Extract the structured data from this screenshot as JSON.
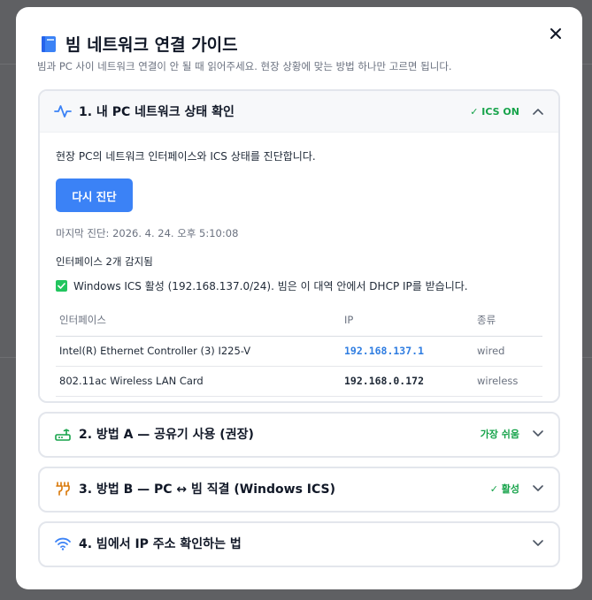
{
  "modal": {
    "title": "빔 네트워크 연결 가이드",
    "subtitle": "빔과 PC 사이 네트워크 연결이 안 될 때 읽어주세요. 현장 상황에 맞는 방법 하나만 고르면 됩니다."
  },
  "sections": [
    {
      "title": "1. 내 PC 네트워크 상태 확인",
      "badge": "✓ ICS ON",
      "icon": "activity-icon",
      "expanded": true,
      "description": "현장 PC의 네트워크 인터페이스와 ICS 상태를 진단합니다.",
      "button_label": "다시 진단",
      "last_diagnosis": "마지막 진단: 2026. 4. 24. 오후 5:10:08",
      "detected_text": "인터페이스 2개 감지됨",
      "ics_status": "Windows ICS 활성 (192.168.137.0/24). 빔은 이 대역 안에서 DHCP IP를 받습니다.",
      "table": {
        "headers": [
          "인터페이스",
          "IP",
          "종류"
        ],
        "rows": [
          {
            "name": "Intel(R) Ethernet Controller (3) I225-V",
            "ip": "192.168.137.1",
            "kind": "wired"
          },
          {
            "name": "802.11ac Wireless LAN Card",
            "ip": "192.168.0.172",
            "kind": "wireless"
          }
        ]
      }
    },
    {
      "title": "2. 방법 A — 공유기 사용 (권장)",
      "badge": "가장 쉬움",
      "icon": "router-icon"
    },
    {
      "title": "3. 방법 B — PC ↔ 빔 직결 (Windows ICS)",
      "badge": "✓ 활성",
      "icon": "plug-icon"
    },
    {
      "title": "4. 빔에서 IP 주소 확인하는 법",
      "badge": "",
      "icon": "wifi-icon"
    }
  ],
  "colors": {
    "accent": "#3b82f6",
    "success": "#16a34a",
    "ip_active": "#2f7de1"
  }
}
